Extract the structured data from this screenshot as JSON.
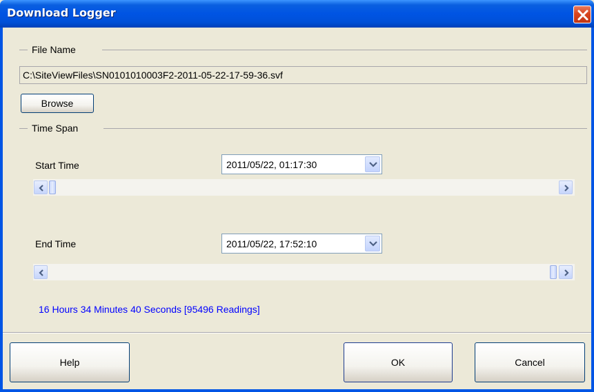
{
  "window": {
    "title": "Download Logger"
  },
  "file_name": {
    "group_label": "File Name",
    "path": "C:\\SiteViewFiles\\SN0101010003F2-2011-05-22-17-59-36.svf",
    "browse_label": "Browse"
  },
  "time_span": {
    "group_label": "Time Span",
    "start": {
      "label": "Start Time",
      "value": "2011/05/22, 01:17:30",
      "slider_position": 0.0
    },
    "end": {
      "label": "End Time",
      "value": "2011/05/22, 17:52:10",
      "slider_position": 1.0
    },
    "summary": "16 Hours 34 Minutes 40 Seconds [95496 Readings]"
  },
  "buttons": {
    "help": "Help",
    "ok": "OK",
    "cancel": "Cancel"
  },
  "icons": {
    "close": "close-icon",
    "combo_arrow": "chevron-down-icon",
    "scroll_left": "chevron-left-icon",
    "scroll_right": "chevron-right-icon"
  },
  "colors": {
    "titlebar": "#0054E3",
    "summary_text": "#0000FF",
    "close_button": "#D8451E"
  }
}
